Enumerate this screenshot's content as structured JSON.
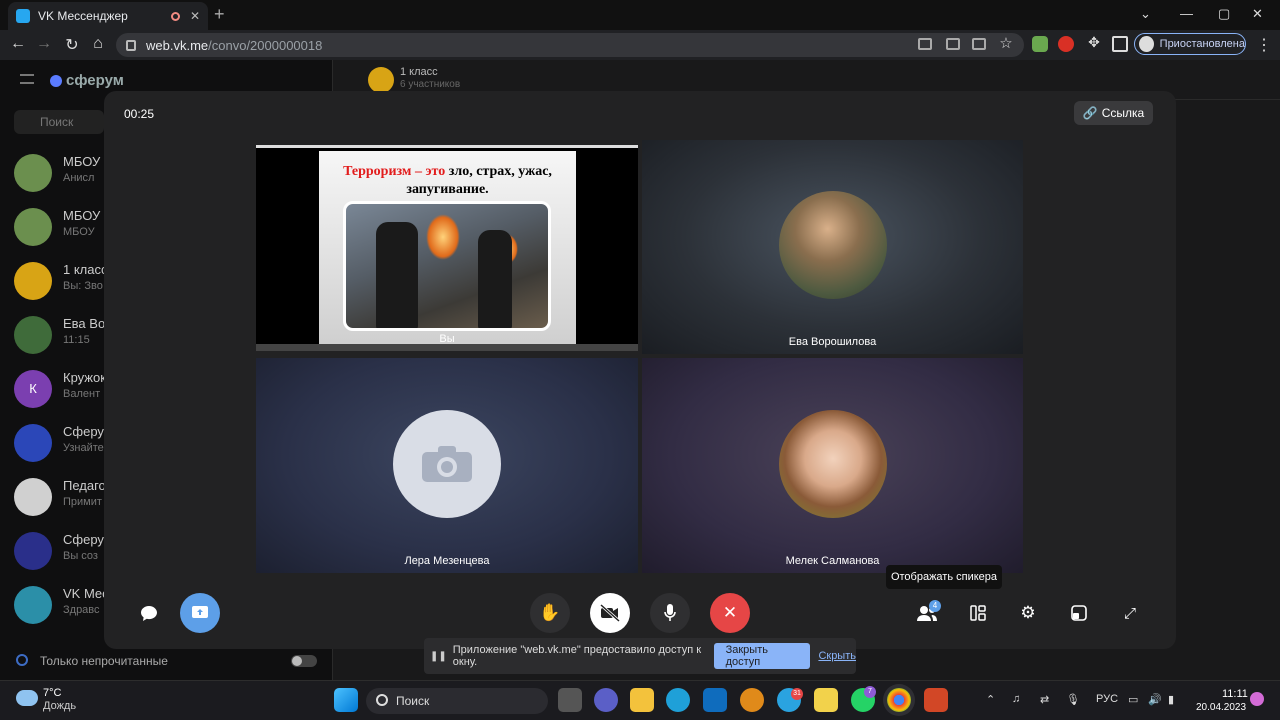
{
  "browser": {
    "tab_title": "VK Мессенджер",
    "url_host": "web.vk.me",
    "url_path": "/convo/2000000018",
    "profile_label": "Приостановлена"
  },
  "app": {
    "logo": "сферум",
    "search_placeholder": "Поиск",
    "chats": [
      {
        "name": "МБОУ",
        "preview": "Анисл",
        "color": "#6b8f4e"
      },
      {
        "name": "МБОУ",
        "preview": "МБОУ",
        "color": "#6b8f4e"
      },
      {
        "name": "1 класс",
        "preview": "Вы: Зво",
        "color": "#d8a415"
      },
      {
        "name": "Ева Во",
        "preview": "11:15",
        "color": "#3f6b3a"
      },
      {
        "name": "Кружок",
        "preview": "Валент",
        "color": "#7b3fb0",
        "letter": "К"
      },
      {
        "name": "Сферум",
        "preview": "Узнайте",
        "color": "#2b47b8"
      },
      {
        "name": "Педаго",
        "preview": "Примит",
        "color": "#d0d0d0"
      },
      {
        "name": "Сферум",
        "preview": "Вы соз",
        "color": "#2a2f8a"
      },
      {
        "name": "VK Мес",
        "preview": "Здравс",
        "color": "#2b8fa8"
      }
    ],
    "unread_only": "Только непрочитанные",
    "conversation_title": "1 класс",
    "conversation_subtitle": "6 участников"
  },
  "call": {
    "timer": "00:25",
    "link_button": "Ссылка",
    "slide_title_red": "Терроризм – это",
    "slide_title_rest": " зло, страх, ужас, запугивание.",
    "participants": [
      "Вы",
      "Ева Ворошилова",
      "Лера Мезенцева",
      "Мелек Салманова"
    ],
    "participants_badge": "4",
    "tooltip": "Отображать спикера"
  },
  "share_banner": {
    "text": "Приложение \"web.vk.me\" предоставило доступ к окну.",
    "stop_button": "Закрыть доступ",
    "hide_link": "Скрыть"
  },
  "taskbar": {
    "temperature": "7°C",
    "weather": "Дождь",
    "search": "Поиск",
    "telegram_badge": "31",
    "whatsapp_badge": "7",
    "language": "РУС",
    "time": "11:11",
    "date": "20.04.2023"
  }
}
